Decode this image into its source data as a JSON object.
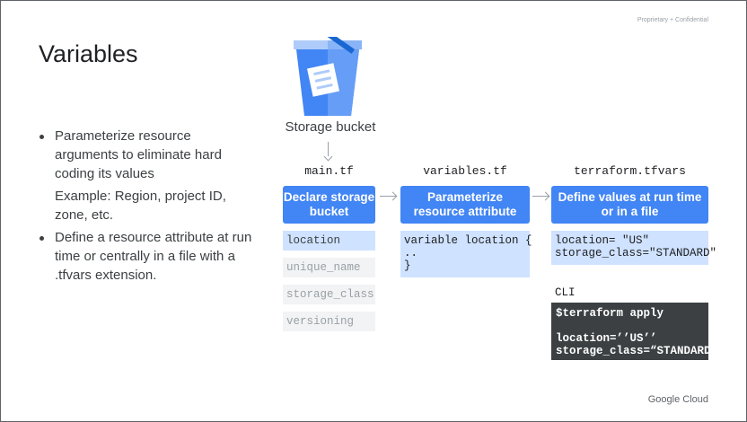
{
  "header": {
    "confidential": "Proprietary + Confidential",
    "title": "Variables"
  },
  "bullets": {
    "b1": "Parameterize resource arguments to eliminate hard coding its values",
    "b1_example": "Example: Region, project ID, zone, etc.",
    "b2": "Define a resource attribute at run time or centrally in a file with a .tfvars extension."
  },
  "diagram": {
    "bucket_caption": "Storage bucket",
    "bucket_icon": "storage-bucket-icon",
    "files": {
      "main": "main.tf",
      "variables": "variables.tf",
      "tfvars": "terraform.tfvars"
    },
    "steps": {
      "declare": "Declare storage bucket",
      "parameterize": "Parameterize resource attribute",
      "define": "Define values at run time or in a file"
    },
    "attributes": [
      "location",
      "unique_name",
      "storage_class",
      "versioning"
    ],
    "variables_code": "variable location {\n..\n}",
    "tfvars_code": "location= \"US\"\nstorage_class=\"STANDARD\"",
    "cli_label": "CLI",
    "cli_code": "$terraform apply\n\nlocation=’’US’’\nstorage_class=“STANDARD”"
  },
  "footer": {
    "brand": "Google Cloud"
  },
  "colors": {
    "accent": "#4285f4",
    "light_blue": "#cfe2ff",
    "dark": "#3c4043"
  }
}
